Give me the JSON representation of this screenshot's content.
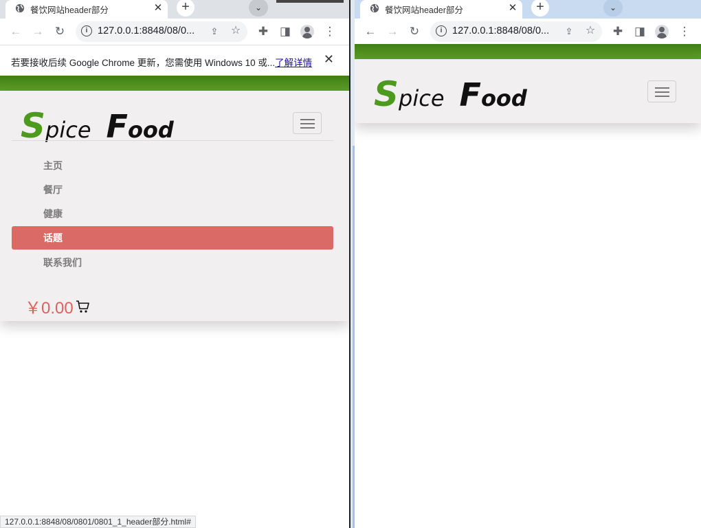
{
  "left_window": {
    "tab": {
      "title": "餐饮网站header部分",
      "close": "✕"
    },
    "new_tab": "+",
    "tab_search": "⌄",
    "url": "127.0.0.1:8848/08/0...",
    "infobar": {
      "message": "若要接收后续 Google Chrome 更新，您需使用 Windows 10 或...",
      "link": "了解详情",
      "close": "✕"
    },
    "logo": {
      "part1": "S",
      "part2": "pice",
      "part3": "F",
      "part4": "ood"
    },
    "nav": [
      {
        "label": "主页",
        "active": false
      },
      {
        "label": "餐厅",
        "active": false
      },
      {
        "label": "健康",
        "active": false
      },
      {
        "label": "话题",
        "active": true
      },
      {
        "label": "联系我们",
        "active": false
      }
    ],
    "cart_total": "￥0.00",
    "status_text": "127.0.0.1:8848/08/0801/0801_1_header部分.html#"
  },
  "right_window": {
    "tab": {
      "title": "餐饮网站header部分",
      "close": "✕"
    },
    "new_tab": "+",
    "tab_search": "⌄",
    "url": "127.0.0.1:8848/08/0...",
    "logo": {
      "part1": "S",
      "part2": "pice",
      "part3": "F",
      "part4": "ood"
    }
  },
  "icons": {
    "back": "←",
    "forward": "→",
    "reload": "↻",
    "share": "⇪",
    "star": "☆",
    "extensions": "✚",
    "sidepanel": "◨",
    "menu": "⋮"
  },
  "colors": {
    "brand_green": "#4c9a1e",
    "active_nav": "#d96a66",
    "price": "#d9645f",
    "header_bg": "#f1efef"
  }
}
